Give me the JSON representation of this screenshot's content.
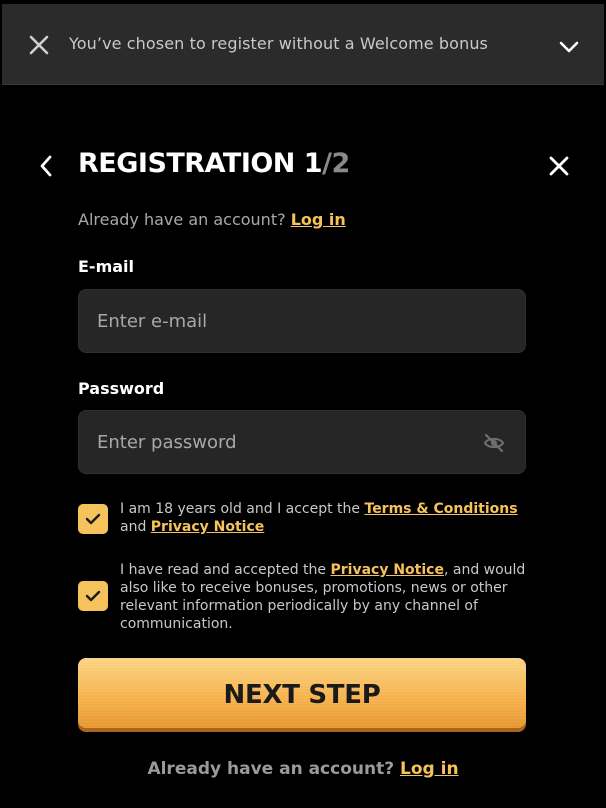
{
  "banner": {
    "text": "You’ve chosen to register without a Welcome bonus",
    "close_icon": "close-icon",
    "expand_icon": "chevron-down-icon"
  },
  "header": {
    "title_main": "REGISTRATION 1",
    "title_suffix": "/2",
    "back_icon": "chevron-left-icon",
    "close_icon": "close-icon"
  },
  "login_prompt": {
    "text": "Already have an account?",
    "link": "Log in"
  },
  "form": {
    "email": {
      "label": "E-mail",
      "placeholder": "Enter e-mail",
      "value": ""
    },
    "password": {
      "label": "Password",
      "placeholder": "Enter password",
      "value": "",
      "toggle_icon": "eye-off-icon"
    }
  },
  "consents": [
    {
      "checked": true,
      "text_before": "I am 18 years old and I accept the ",
      "link1": "Terms & Conditions",
      "text_mid": " and ",
      "link2": "Privacy Notice"
    },
    {
      "checked": true,
      "text_before": "I have read and accepted the ",
      "link1": "Privacy Notice",
      "text_after": ", and would also like to receive bonuses, promotions, news or other relevant information periodically by any channel of communication."
    }
  ],
  "next_button": {
    "label": "NEXT STEP"
  },
  "footer_login": {
    "text": "Already have an account?",
    "link": "Log in"
  },
  "colors": {
    "accent": "#f5c25b",
    "background": "#000000",
    "input_bg": "#262626"
  }
}
